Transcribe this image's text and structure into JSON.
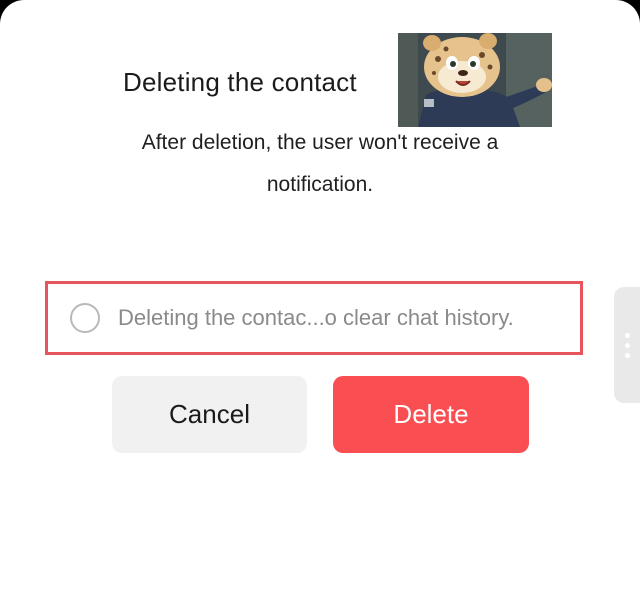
{
  "dialog": {
    "title": "Deleting the contact",
    "message": "After deletion, the user won't receive a notification.",
    "option_label": "Deleting the contac...o clear chat history.",
    "cancel_label": "Cancel",
    "delete_label": "Delete",
    "sticker_icon": "cheetah-officer-sticker",
    "handle_icon": "drag-handle-icon"
  },
  "colors": {
    "delete_button": "#f94e52",
    "cancel_button": "#f1f1f1",
    "highlight_border": "#e8545c",
    "sheet_background": "#ffffff"
  }
}
